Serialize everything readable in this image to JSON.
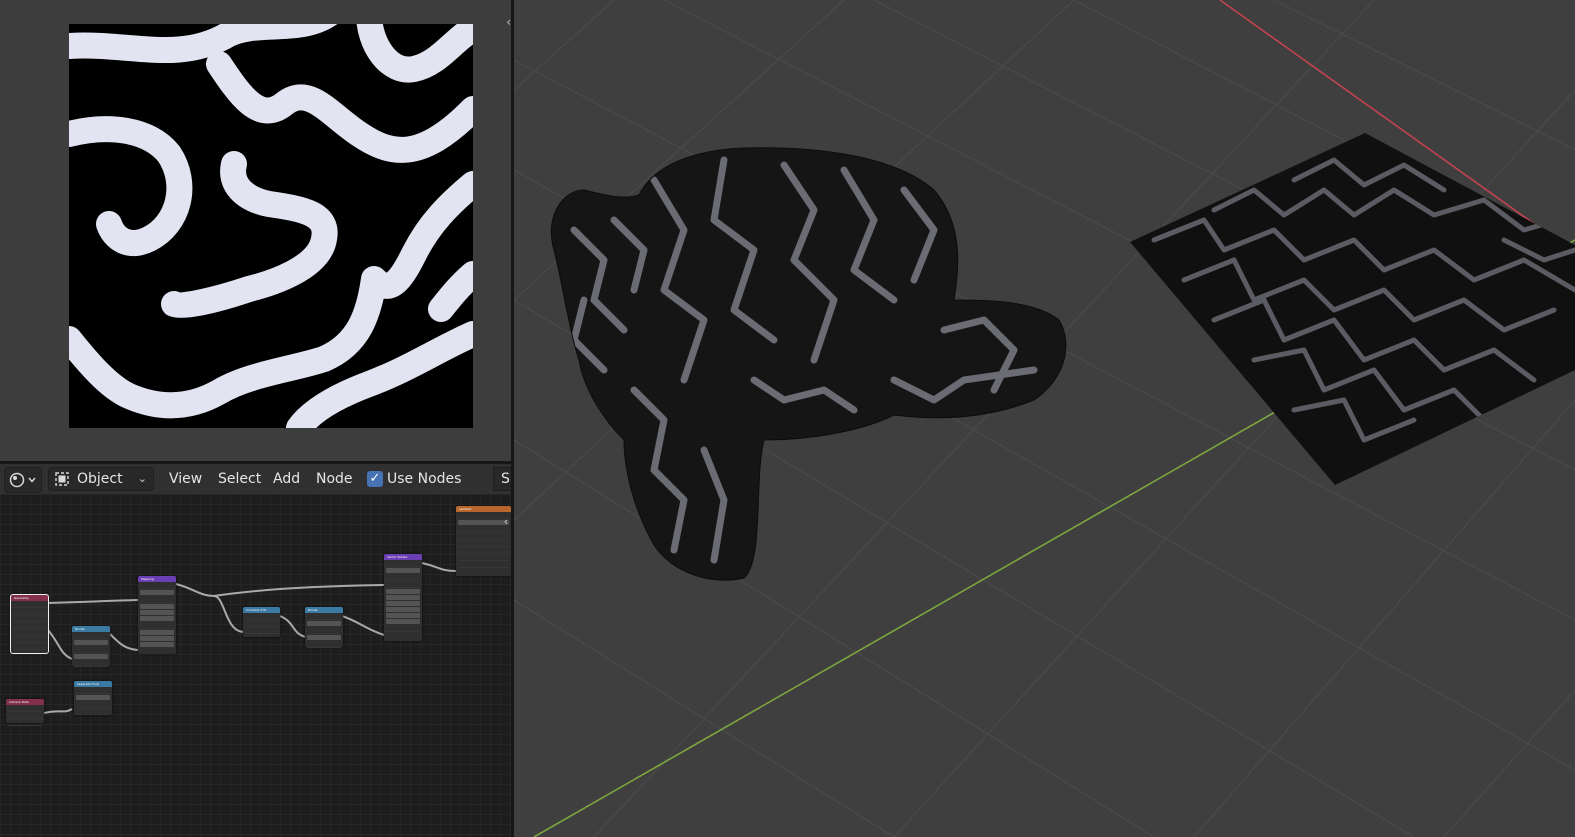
{
  "image_editor": {
    "split_handle_icon": "split-arrows-icon"
  },
  "node_editor": {
    "header": {
      "editor_type_icon": "node-editor-icon",
      "shader_type": "Object",
      "menus": [
        "View",
        "Select",
        "Add",
        "Node"
      ],
      "use_nodes_label": "Use Nodes",
      "use_nodes_checked": true,
      "slot_label_truncated": "S"
    },
    "nodes": [
      {
        "title": "Geometry",
        "category": "input"
      },
      {
        "title": "Mapping",
        "category": "vector"
      },
      {
        "title": "Divide",
        "category": "converter"
      },
      {
        "title": "Separate Float",
        "category": "converter"
      },
      {
        "title": "Camera Data",
        "category": "input"
      },
      {
        "title": "Combine XYZ",
        "category": "converter"
      },
      {
        "title": "Divide",
        "category": "converter"
      },
      {
        "title": "Vector Rotate",
        "category": "vector"
      },
      {
        "title": "Lambert",
        "category": "output"
      }
    ]
  },
  "colors": {
    "panel_bg": "#303030",
    "viewport_bg": "#3f3f3f",
    "x_axis": "#c0434f",
    "y_axis": "#7ea63e",
    "accent": "#4772b3"
  },
  "viewport": {
    "objects": [
      "Suzanne",
      "Plane"
    ],
    "toggle_icon": "sidebar-toggle-icon"
  }
}
